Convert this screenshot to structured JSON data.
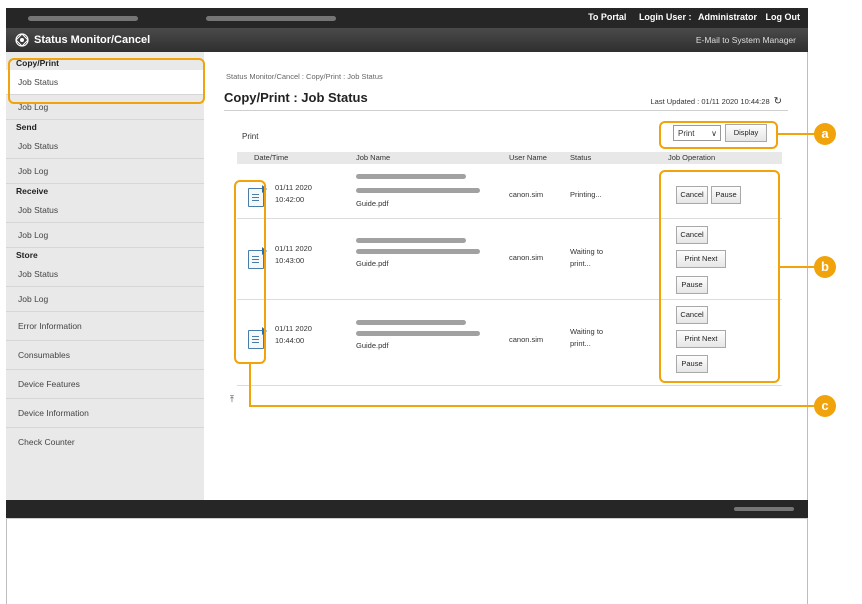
{
  "topbar": {
    "links": [
      "To Portal",
      "Login User :",
      "Administrator",
      "Log Out"
    ]
  },
  "titlebar": {
    "title": "Status Monitor/Cancel",
    "email_link": "E-Mail to System Manager"
  },
  "sidebar": {
    "sections": [
      {
        "heading": "Copy/Print",
        "items": [
          "Job Status",
          "Job Log"
        ]
      },
      {
        "heading": "Send",
        "items": [
          "Job Status",
          "Job Log"
        ]
      },
      {
        "heading": "Receive",
        "items": [
          "Job Status",
          "Job Log"
        ]
      },
      {
        "heading": "Store",
        "items": [
          "Job Status",
          "Job Log"
        ]
      }
    ],
    "top_items": [
      "Error Information",
      "Consumables",
      "Device Features",
      "Device Information",
      "Check Counter"
    ]
  },
  "main": {
    "breadcrumb": "Status Monitor/Cancel : Copy/Print : Job Status",
    "page_title": "Copy/Print : Job Status",
    "last_updated": "Last Updated : 01/11 2020 10:44:28",
    "section_label": "Print",
    "filter_select": "Print",
    "display_button": "Display",
    "columns": [
      "Date/Time",
      "Job Name",
      "User Name",
      "Status",
      "Job Operation"
    ],
    "jobs": [
      {
        "date": "01/11 2020",
        "time": "10:42:00",
        "job_name_suffix": "Guide.pdf",
        "user": "canon.sim",
        "status_line1": "Printing...",
        "status_line2": "",
        "buttons": [
          "Cancel",
          "Pause"
        ]
      },
      {
        "date": "01/11 2020",
        "time": "10:43:00",
        "job_name_suffix": "Guide.pdf",
        "user": "canon.sim",
        "status_line1": "Waiting to",
        "status_line2": "print...",
        "buttons": [
          "Cancel",
          "Print Next",
          "Pause"
        ]
      },
      {
        "date": "01/11 2020",
        "time": "10:44:00",
        "job_name_suffix": "Guide.pdf",
        "user": "canon.sim",
        "status_line1": "Waiting to",
        "status_line2": "print...",
        "buttons": [
          "Cancel",
          "Print Next",
          "Pause"
        ]
      }
    ]
  },
  "callouts": [
    "a",
    "b",
    "c"
  ],
  "colors": {
    "accent": "#f0a30a",
    "dark_bar": "#262626",
    "sidebar_bg": "#e9e9e9"
  }
}
